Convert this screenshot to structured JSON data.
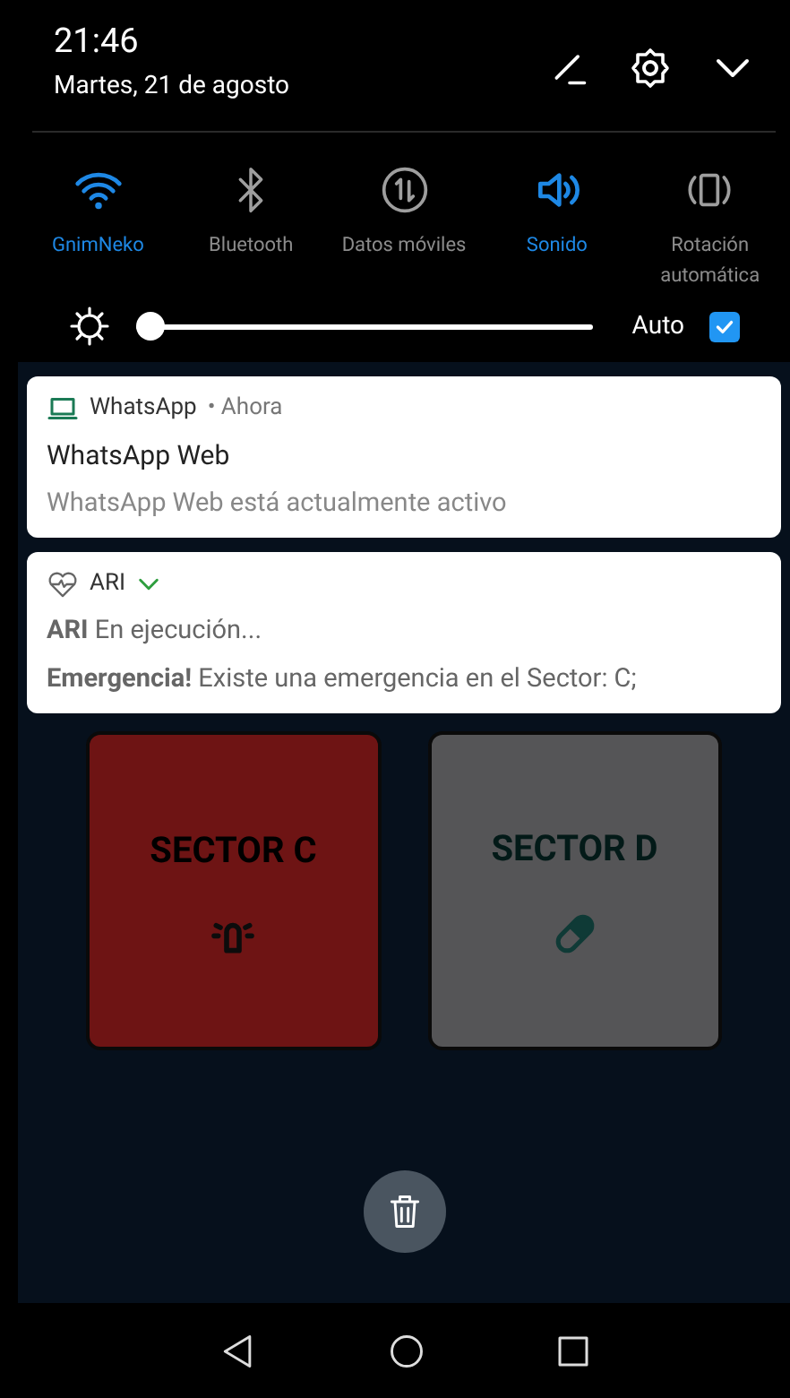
{
  "header": {
    "time": "21:46",
    "date": "Martes, 21 de agosto"
  },
  "toggles": [
    {
      "label": "GnimNeko",
      "kind": "wifi",
      "on": true
    },
    {
      "label": "Bluetooth",
      "kind": "bluetooth",
      "on": false
    },
    {
      "label": "Datos móviles",
      "kind": "data",
      "on": false
    },
    {
      "label": "Sonido",
      "kind": "sound",
      "on": true
    },
    {
      "label": "Rotación automática",
      "kind": "rotation",
      "on": false
    }
  ],
  "brightness": {
    "level": 0.0,
    "auto_label": "Auto",
    "auto_checked": true
  },
  "notifications": [
    {
      "kind": "laptop",
      "app": "WhatsApp",
      "time": "• Ahora",
      "title": "WhatsApp Web",
      "lines": [
        "WhatsApp Web está actualmente activo"
      ]
    },
    {
      "kind": "heart",
      "app": "ARI",
      "expanded": true,
      "lines": [
        "**ARI** En ejecución...",
        "**Emergencia!** Existe una emergencia en el Sector: C;"
      ]
    }
  ],
  "sectors": [
    {
      "label": "SECTOR C",
      "kind": "alarm",
      "color": "#6e1414"
    },
    {
      "label": "SECTOR D",
      "kind": "pill",
      "color": "#555557"
    }
  ]
}
